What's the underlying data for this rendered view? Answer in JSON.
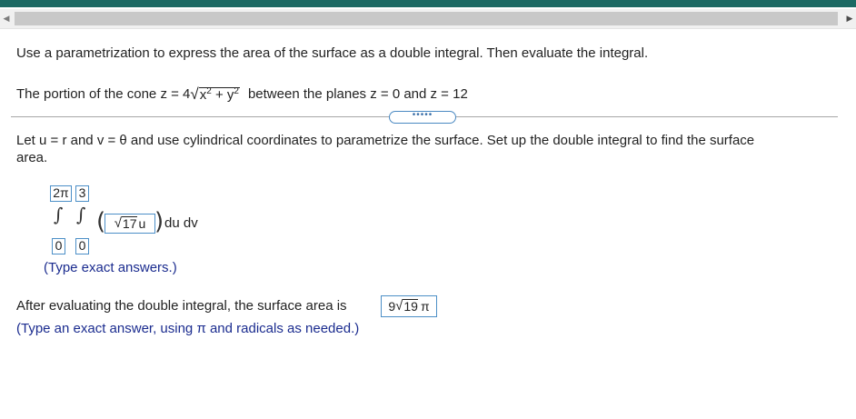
{
  "header": {
    "scroll_left": "◀",
    "scroll_right": "▶"
  },
  "question": {
    "instruction": "Use a parametrization to express the area of the surface as a double integral. Then evaluate the integral.",
    "portion_prefix": "The portion of the cone z = 4",
    "radicand": "x",
    "radicand_plus": " + y",
    "exp": "2",
    "portion_suffix": "between the planes z = 0 and z = 12",
    "more_button": "•••••",
    "step_line1": "Let u = r and v = θ and use cylindrical coordinates to parametrize the surface. Set up the double integral to find the surface",
    "step_line2": "area."
  },
  "integral": {
    "outer_upper": "2π",
    "inner_upper": "3",
    "outer_lower": "0",
    "inner_lower": "0",
    "integrand_radicand": "17",
    "integrand_var": "u",
    "differentials": "du dv",
    "hint": "(Type exact answers.)"
  },
  "result": {
    "text": "After evaluating the double integral, the surface area is",
    "answer_coeff": "9",
    "answer_radicand": "19",
    "answer_pi": "π",
    "hint": "(Type an exact answer, using π and radicals as needed.)"
  }
}
